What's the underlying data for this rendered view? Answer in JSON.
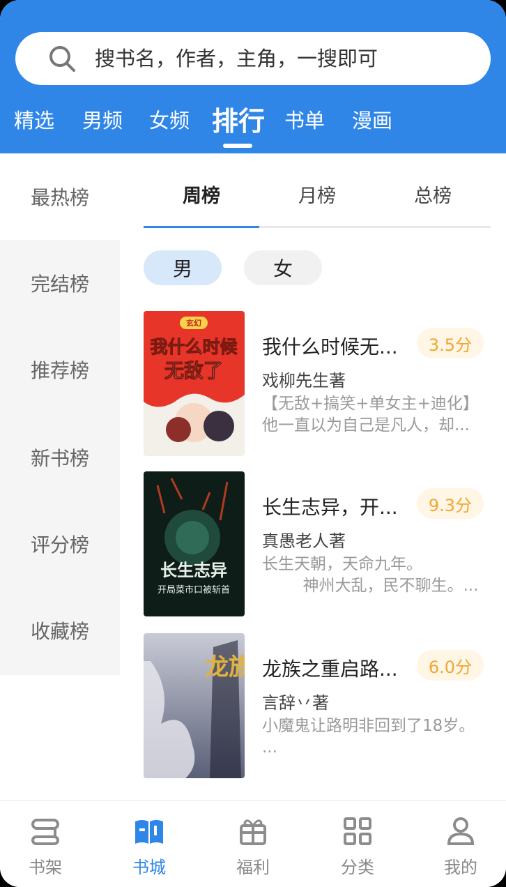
{
  "search": {
    "placeholder": "搜书名，作者，主角，一搜即可"
  },
  "topnav": {
    "items": [
      "精选",
      "男频",
      "女频",
      "排行",
      "书单",
      "漫画"
    ],
    "active_index": 3
  },
  "sidebar": {
    "items": [
      "最热榜",
      "完结榜",
      "推荐榜",
      "新书榜",
      "评分榜",
      "收藏榜"
    ],
    "active_index": 0
  },
  "rank_tabs": {
    "items": [
      "周榜",
      "月榜",
      "总榜"
    ],
    "active_index": 0
  },
  "gender": {
    "items": [
      "男",
      "女"
    ],
    "active_index": 0
  },
  "books": [
    {
      "title": "我什么时候无...",
      "score": "3.5分",
      "author": "戏柳先生著",
      "desc": "【无敌+搞笑+单女主+迪化】他一直以为自己是凡人，却..."
    },
    {
      "title": "长生志异，开...",
      "score": "9.3分",
      "author": "真愚老人著",
      "desc": "长生天朝，天命九年。\n        神州大乱，民不聊生。..."
    },
    {
      "title": "龙族之重启路...",
      "score": "6.0分",
      "author": "言辞丷著",
      "desc": "小魔鬼让路明非回到了18岁。 ..."
    }
  ],
  "covers": [
    {
      "text_line1": "我什么时候",
      "text_line2": "无敌了",
      "badge": "玄幻"
    },
    {
      "text_line1": "长生志异",
      "text_line2": "开局菜市口被斩首"
    },
    {
      "text_line1": "龙族"
    }
  ],
  "bottombar": {
    "items": [
      {
        "label": "书架",
        "icon": "bookshelf-icon"
      },
      {
        "label": "书城",
        "icon": "book-open-icon"
      },
      {
        "label": "福利",
        "icon": "gift-icon"
      },
      {
        "label": "分类",
        "icon": "grid-icon"
      },
      {
        "label": "我的",
        "icon": "user-icon"
      }
    ],
    "active_index": 1
  },
  "colors": {
    "primary": "#2f86e6",
    "score_text": "#f0a632",
    "score_bg": "#fff6e6"
  }
}
